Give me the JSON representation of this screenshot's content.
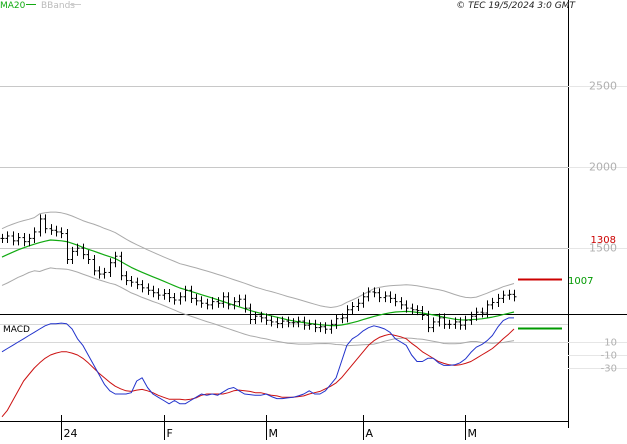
{
  "header": {
    "legend_ma": "MA20",
    "legend_bb": "BBands",
    "copyright": "© TEC 19/5/2024 3:0 GMT"
  },
  "colors": {
    "ma": "#11aa11",
    "bands": "#aaaaaa",
    "price": "#000000",
    "macd": "#2233cc",
    "signal": "#cc1111",
    "resistance": "#cc0000",
    "support": "#009900",
    "grid": "#c8c8c8",
    "axis_text": "#b0b0b0"
  },
  "chart_data": [
    {
      "type": "line",
      "subtype": "ohlc-bar",
      "panel": "price",
      "yticks": [
        "2500",
        "2000",
        "1500"
      ],
      "ytick_values": [
        2500,
        2000,
        1500
      ],
      "ylim": [
        1100,
        2950
      ],
      "x_labels": [
        "24",
        "F",
        "M",
        "A",
        "M"
      ],
      "x_label_index": [
        11,
        30,
        49,
        67,
        86
      ],
      "n_sessions": 96,
      "levels": {
        "resistance": "1308",
        "support": "1007"
      },
      "series": [
        {
          "name": "Price",
          "values": [
            1560,
            1575,
            1545,
            1565,
            1540,
            1560,
            1600,
            1680,
            1620,
            1610,
            1600,
            1590,
            1430,
            1480,
            1500,
            1460,
            1430,
            1360,
            1340,
            1350,
            1410,
            1450,
            1330,
            1300,
            1290,
            1275,
            1255,
            1240,
            1225,
            1210,
            1220,
            1195,
            1180,
            1200,
            1240,
            1190,
            1175,
            1160,
            1150,
            1170,
            1160,
            1200,
            1150,
            1170,
            1185,
            1130,
            1060,
            1080,
            1070,
            1055,
            1045,
            1035,
            1050,
            1040,
            1040,
            1050,
            1025,
            1030,
            1010,
            1015,
            1000,
            1030,
            1065,
            1070,
            1120,
            1140,
            1160,
            1200,
            1230,
            1225,
            1195,
            1205,
            1190,
            1170,
            1150,
            1130,
            1120,
            1115,
            1085,
            1010,
            1045,
            1070,
            1030,
            1030,
            1045,
            1025,
            1055,
            1080,
            1105,
            1100,
            1150,
            1165,
            1190,
            1210,
            1215,
            1200
          ]
        },
        {
          "name": "MA20",
          "values": [
            1445,
            1460,
            1475,
            1490,
            1502,
            1514,
            1524,
            1534,
            1543,
            1550,
            1548,
            1545,
            1540,
            1530,
            1518,
            1505,
            1493,
            1482,
            1470,
            1458,
            1447,
            1436,
            1418,
            1399,
            1381,
            1366,
            1351,
            1337,
            1323,
            1310,
            1296,
            1282,
            1268,
            1254,
            1244,
            1234,
            1224,
            1213,
            1203,
            1193,
            1182,
            1171,
            1160,
            1149,
            1138,
            1127,
            1116,
            1107,
            1098,
            1090,
            1082,
            1074,
            1066,
            1058,
            1052,
            1046,
            1041,
            1036,
            1032,
            1028,
            1025,
            1022,
            1022,
            1026,
            1032,
            1040,
            1049,
            1059,
            1069,
            1079,
            1087,
            1095,
            1101,
            1106,
            1108,
            1110,
            1108,
            1104,
            1100,
            1094,
            1088,
            1082,
            1074,
            1068,
            1062,
            1058,
            1057,
            1059,
            1061,
            1064,
            1069,
            1075,
            1082,
            1090,
            1098,
            1106
          ]
        },
        {
          "name": "BBands upper",
          "values": [
            1620,
            1635,
            1648,
            1660,
            1670,
            1678,
            1688,
            1712,
            1718,
            1722,
            1722,
            1718,
            1710,
            1698,
            1684,
            1670,
            1658,
            1648,
            1636,
            1622,
            1610,
            1596,
            1576,
            1556,
            1538,
            1521,
            1506,
            1490,
            1475,
            1460,
            1446,
            1432,
            1418,
            1404,
            1396,
            1387,
            1378,
            1368,
            1359,
            1349,
            1338,
            1328,
            1317,
            1306,
            1295,
            1284,
            1272,
            1260,
            1250,
            1240,
            1232,
            1222,
            1212,
            1202,
            1193,
            1184,
            1174,
            1164,
            1154,
            1145,
            1138,
            1134,
            1138,
            1148,
            1166,
            1180,
            1196,
            1214,
            1232,
            1250,
            1258,
            1264,
            1268,
            1270,
            1272,
            1274,
            1272,
            1268,
            1262,
            1256,
            1250,
            1244,
            1236,
            1226,
            1214,
            1204,
            1196,
            1194,
            1198,
            1210,
            1222,
            1236,
            1248,
            1262,
            1272,
            1282
          ]
        },
        {
          "name": "BBands lower",
          "values": [
            1270,
            1285,
            1302,
            1320,
            1334,
            1350,
            1360,
            1356,
            1368,
            1378,
            1374,
            1372,
            1370,
            1362,
            1352,
            1340,
            1328,
            1316,
            1304,
            1294,
            1284,
            1276,
            1260,
            1242,
            1224,
            1211,
            1196,
            1184,
            1171,
            1160,
            1146,
            1132,
            1118,
            1104,
            1092,
            1081,
            1070,
            1058,
            1047,
            1037,
            1026,
            1014,
            1003,
            992,
            981,
            970,
            960,
            954,
            946,
            940,
            932,
            926,
            920,
            914,
            911,
            908,
            908,
            908,
            910,
            911,
            912,
            910,
            906,
            904,
            898,
            900,
            902,
            904,
            906,
            908,
            916,
            926,
            934,
            942,
            944,
            946,
            944,
            940,
            938,
            932,
            926,
            920,
            912,
            910,
            910,
            912,
            918,
            924,
            924,
            918,
            916,
            914,
            916,
            918,
            924,
            930
          ]
        }
      ]
    },
    {
      "type": "line",
      "panel": "macd",
      "title": "MACD",
      "yticks": [
        "10",
        "-10",
        "-30"
      ],
      "ytick_values": [
        10,
        -10,
        -30
      ],
      "ylim": [
        -110,
        50
      ],
      "series": [
        {
          "name": "MACD",
          "values": [
            -5,
            0,
            5,
            10,
            15,
            20,
            25,
            30,
            35,
            38,
            38,
            39,
            38,
            30,
            15,
            5,
            -10,
            -25,
            -40,
            -55,
            -65,
            -70,
            -70,
            -70,
            -68,
            -50,
            -45,
            -60,
            -70,
            -75,
            -80,
            -85,
            -80,
            -85,
            -85,
            -80,
            -75,
            -70,
            -72,
            -70,
            -72,
            -67,
            -62,
            -60,
            -65,
            -70,
            -71,
            -72,
            -72,
            -70,
            -74,
            -77,
            -77,
            -76,
            -75,
            -73,
            -70,
            -65,
            -70,
            -70,
            -65,
            -55,
            -45,
            -20,
            5,
            15,
            20,
            27,
            32,
            35,
            33,
            30,
            25,
            15,
            10,
            5,
            -10,
            -20,
            -20,
            -15,
            -15,
            -22,
            -26,
            -26,
            -25,
            -22,
            -16,
            -6,
            2,
            6,
            12,
            20,
            33,
            43,
            47,
            47
          ]
        },
        {
          "name": "Signal",
          "values": [
            -105,
            -95,
            -80,
            -65,
            -50,
            -40,
            -30,
            -22,
            -15,
            -10,
            -7,
            -5,
            -5,
            -7,
            -10,
            -15,
            -22,
            -30,
            -38,
            -45,
            -52,
            -58,
            -62,
            -65,
            -66,
            -64,
            -63,
            -65,
            -68,
            -72,
            -75,
            -78,
            -78,
            -78,
            -79,
            -78,
            -76,
            -72,
            -70,
            -70,
            -70,
            -70,
            -68,
            -65,
            -64,
            -65,
            -66,
            -68,
            -68,
            -70,
            -72,
            -73,
            -75,
            -75,
            -75,
            -74,
            -73,
            -70,
            -68,
            -66,
            -62,
            -58,
            -53,
            -45,
            -35,
            -25,
            -15,
            -5,
            5,
            12,
            17,
            20,
            22,
            20,
            18,
            15,
            8,
            2,
            -5,
            -10,
            -15,
            -20,
            -23,
            -25,
            -26,
            -25,
            -23,
            -20,
            -15,
            -10,
            -5,
            0,
            7,
            15,
            22,
            30
          ]
        }
      ]
    }
  ]
}
